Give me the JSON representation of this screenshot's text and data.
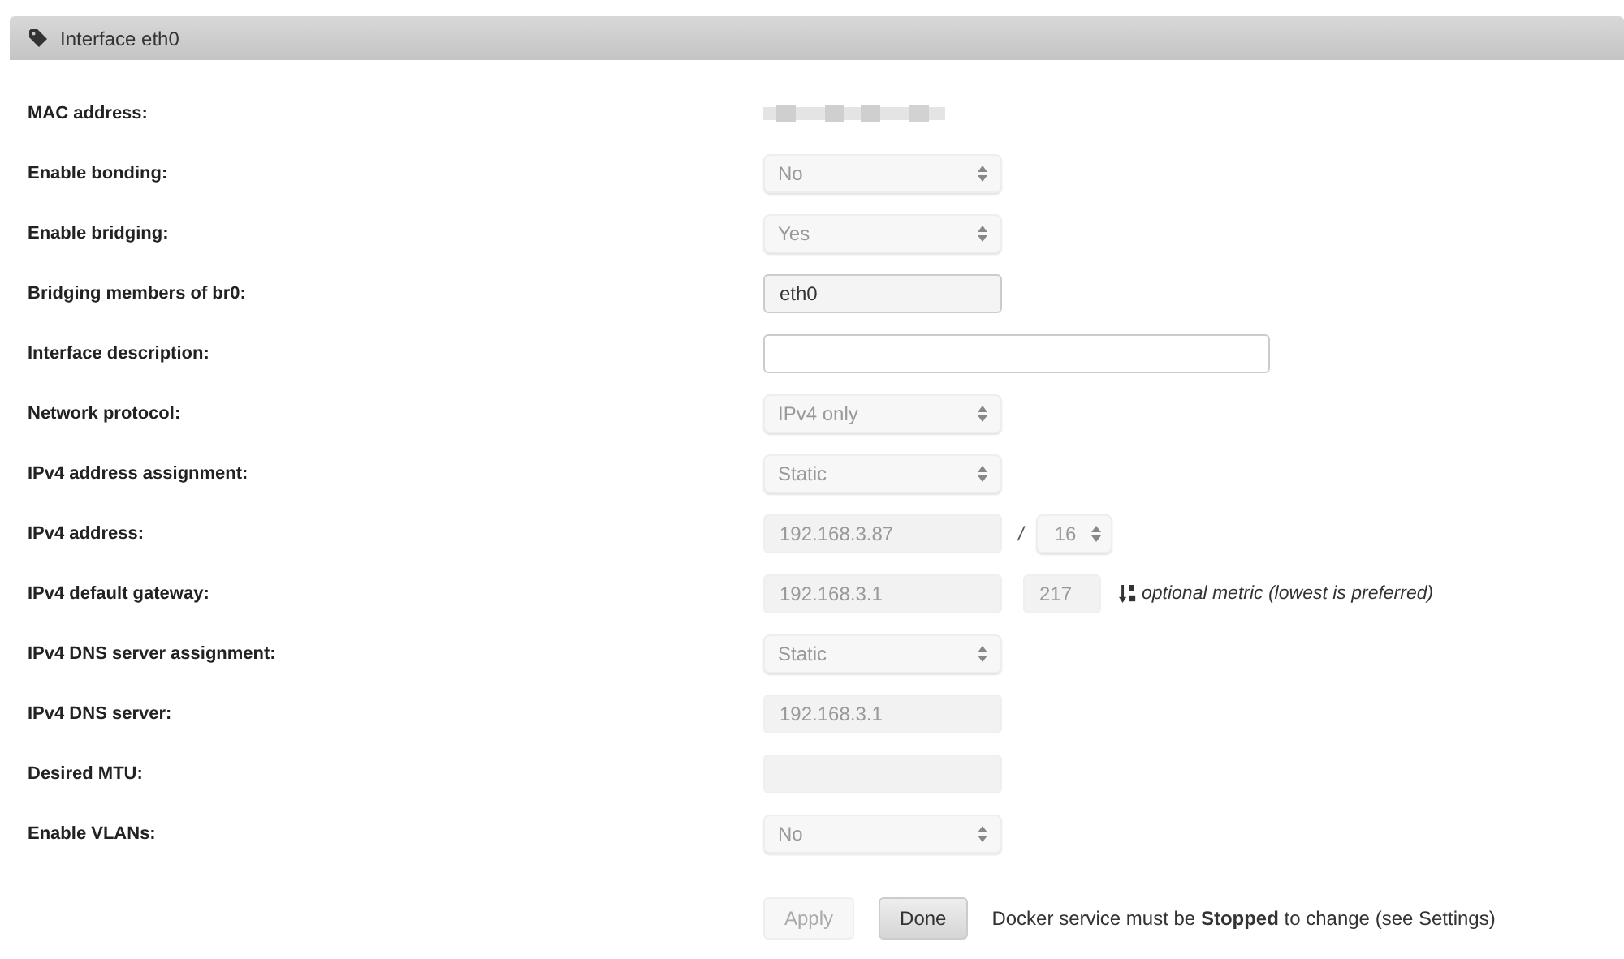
{
  "panel": {
    "title": "Interface eth0"
  },
  "rows": [
    {
      "label": "MAC address:",
      "kind": "redacted"
    },
    {
      "label": "Enable bonding:",
      "kind": "select",
      "value": "No",
      "disabled": true
    },
    {
      "label": "Enable bridging:",
      "kind": "select",
      "value": "Yes",
      "disabled": true
    },
    {
      "label": "Bridging members of br0:",
      "kind": "text",
      "value": "eth0",
      "disabled": false
    },
    {
      "label": "Interface description:",
      "kind": "text",
      "wide": true,
      "disabled": false
    },
    {
      "label": "Network protocol:",
      "kind": "select",
      "value": "IPv4 only",
      "disabled": true
    },
    {
      "label": "IPv4 address assignment:",
      "kind": "select",
      "value": "Static",
      "disabled": true
    },
    {
      "label": "IPv4 address:",
      "kind": "address",
      "value": "192.168.3.87",
      "separator": "/",
      "prefix": "16",
      "disabled": true
    },
    {
      "label": "IPv4 default gateway:",
      "kind": "gateway",
      "value": "192.168.3.1",
      "metric": "217",
      "hint": "optional metric (lowest is preferred)",
      "disabled": true
    },
    {
      "label": "IPv4 DNS server assignment:",
      "kind": "select",
      "value": "Static",
      "disabled": true
    },
    {
      "label": "IPv4 DNS server:",
      "kind": "text",
      "value": "192.168.3.1",
      "disabled": true
    },
    {
      "label": "Desired MTU:",
      "kind": "text",
      "disabled": true
    },
    {
      "label": "Enable VLANs:",
      "kind": "select",
      "value": "No",
      "disabled": true
    }
  ],
  "buttons": [
    {
      "label": "Apply",
      "disabled": true
    },
    {
      "label": "Done",
      "disabled": false
    }
  ],
  "note": "Docker service must be **Stopped** to change (see Settings)"
}
